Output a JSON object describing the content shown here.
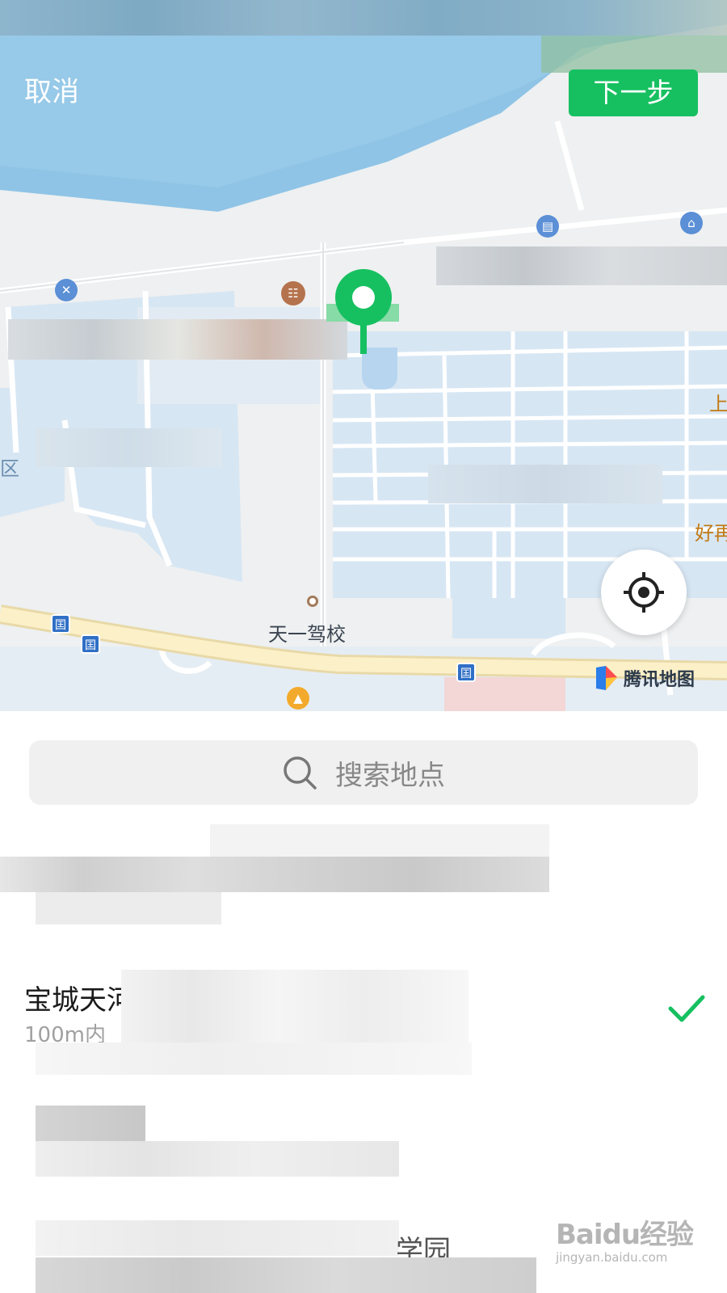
{
  "header": {
    "cancel_label": "取消",
    "next_label": "下一步"
  },
  "map": {
    "labels": {
      "driving_school": "天一驾校",
      "edge_shang": "上",
      "edge_hao": "好再",
      "edge_qu": "区"
    },
    "icons": {
      "bus_stop": "囯"
    },
    "provider": "腾讯地图",
    "colors": {
      "water": "#8fc4e6",
      "land": "#eef0f1",
      "block": "#d7e6f3",
      "road": "#ffffff",
      "main_road": "#fbf0c8",
      "pin": "#16c060"
    }
  },
  "search": {
    "placeholder": "搜索地点"
  },
  "locations": [
    {
      "title": "",
      "subtitle": ""
    },
    {
      "title": "宝城天河",
      "subtitle": "100m内",
      "selected": true
    },
    {
      "title": "",
      "subtitle": ""
    },
    {
      "title": "学园",
      "subtitle": ""
    }
  ],
  "watermark": {
    "brand": "Baidu经验",
    "url": "jingyan.baidu.com"
  },
  "accent_color": "#16c060"
}
